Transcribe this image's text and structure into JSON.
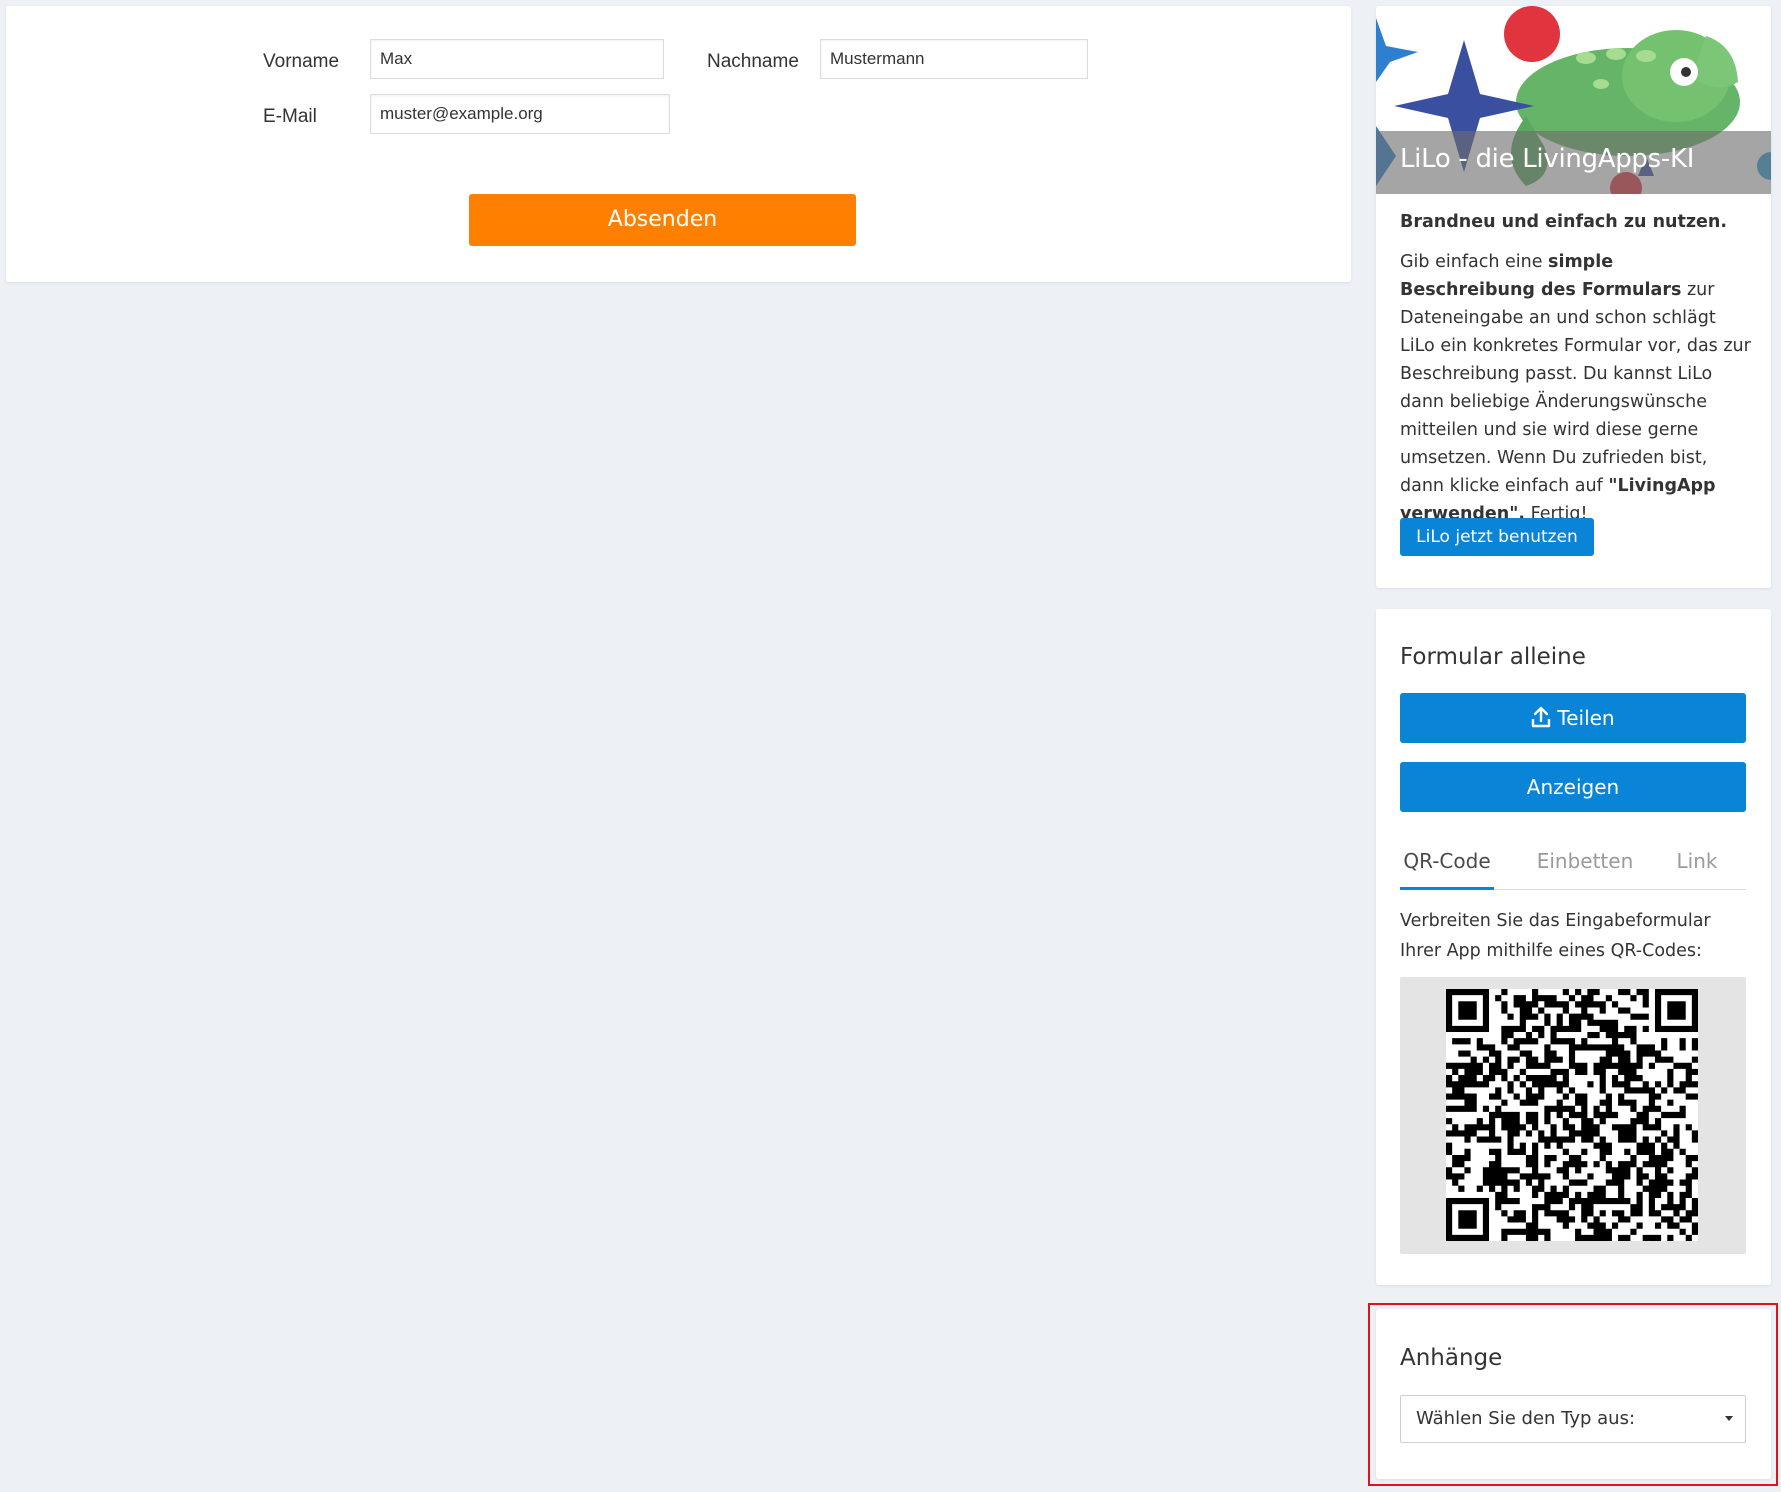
{
  "form": {
    "vorname_label": "Vorname",
    "vorname_value": "Max",
    "nachname_label": "Nachname",
    "nachname_value": "Mustermann",
    "email_label": "E-Mail",
    "email_value": "muster@example.org",
    "submit_label": "Absenden"
  },
  "lilo": {
    "hero_title": "LiLo - die LivingApps-KI",
    "lead": "Brandneu und einfach zu nutzen.",
    "text_part1": "Gib einfach eine ",
    "text_bold1": "simple Beschreibung des Formulars",
    "text_part2": " zur Dateneingabe an und schon schlägt LiLo ein konkretes Formular vor, das zur Beschreibung passt. Du kannst LiLo dann beliebige Änderungswünsche mitteilen und sie wird diese gerne umsetzen. Wenn Du zufrieden bist, dann klicke einfach auf ",
    "text_bold2": "\"LivingApp verwenden\".",
    "text_part3": " Fertig!",
    "button_label": "LiLo jetzt benutzen"
  },
  "formular": {
    "title": "Formular alleine",
    "share_label": "Teilen",
    "share_icon": "upload-icon",
    "show_label": "Anzeigen",
    "tabs": [
      {
        "label": "QR-Code",
        "active": true
      },
      {
        "label": "Einbetten",
        "active": false
      },
      {
        "label": "Link",
        "active": false
      }
    ],
    "qr_description": "Verbreiten Sie das Eingabeformular Ihrer App mithilfe eines QR-Codes:"
  },
  "anhaenge": {
    "title": "Anhänge",
    "select_value": "Wählen Sie den Typ aus:"
  },
  "colors": {
    "accent_orange": "#ff8000",
    "accent_blue": "#0a84d6",
    "page_bg": "#edf1f5",
    "highlight_red": "#e0121a"
  }
}
